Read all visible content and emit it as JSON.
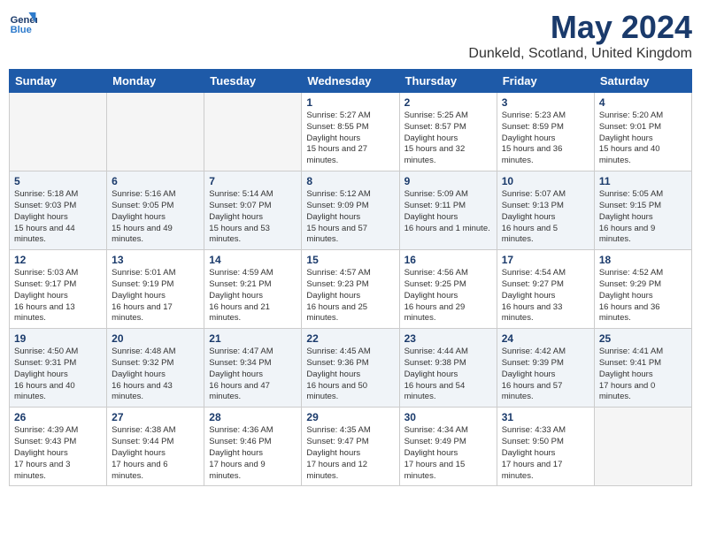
{
  "logo": {
    "line1": "General",
    "line2": "Blue"
  },
  "title": "May 2024",
  "subtitle": "Dunkeld, Scotland, United Kingdom",
  "days_of_week": [
    "Sunday",
    "Monday",
    "Tuesday",
    "Wednesday",
    "Thursday",
    "Friday",
    "Saturday"
  ],
  "weeks": [
    [
      {
        "day": "",
        "empty": true
      },
      {
        "day": "",
        "empty": true
      },
      {
        "day": "",
        "empty": true
      },
      {
        "day": "1",
        "sunrise": "5:27 AM",
        "sunset": "8:55 PM",
        "daylight": "15 hours and 27 minutes."
      },
      {
        "day": "2",
        "sunrise": "5:25 AM",
        "sunset": "8:57 PM",
        "daylight": "15 hours and 32 minutes."
      },
      {
        "day": "3",
        "sunrise": "5:23 AM",
        "sunset": "8:59 PM",
        "daylight": "15 hours and 36 minutes."
      },
      {
        "day": "4",
        "sunrise": "5:20 AM",
        "sunset": "9:01 PM",
        "daylight": "15 hours and 40 minutes."
      }
    ],
    [
      {
        "day": "5",
        "sunrise": "5:18 AM",
        "sunset": "9:03 PM",
        "daylight": "15 hours and 44 minutes."
      },
      {
        "day": "6",
        "sunrise": "5:16 AM",
        "sunset": "9:05 PM",
        "daylight": "15 hours and 49 minutes."
      },
      {
        "day": "7",
        "sunrise": "5:14 AM",
        "sunset": "9:07 PM",
        "daylight": "15 hours and 53 minutes."
      },
      {
        "day": "8",
        "sunrise": "5:12 AM",
        "sunset": "9:09 PM",
        "daylight": "15 hours and 57 minutes."
      },
      {
        "day": "9",
        "sunrise": "5:09 AM",
        "sunset": "9:11 PM",
        "daylight": "16 hours and 1 minute."
      },
      {
        "day": "10",
        "sunrise": "5:07 AM",
        "sunset": "9:13 PM",
        "daylight": "16 hours and 5 minutes."
      },
      {
        "day": "11",
        "sunrise": "5:05 AM",
        "sunset": "9:15 PM",
        "daylight": "16 hours and 9 minutes."
      }
    ],
    [
      {
        "day": "12",
        "sunrise": "5:03 AM",
        "sunset": "9:17 PM",
        "daylight": "16 hours and 13 minutes."
      },
      {
        "day": "13",
        "sunrise": "5:01 AM",
        "sunset": "9:19 PM",
        "daylight": "16 hours and 17 minutes."
      },
      {
        "day": "14",
        "sunrise": "4:59 AM",
        "sunset": "9:21 PM",
        "daylight": "16 hours and 21 minutes."
      },
      {
        "day": "15",
        "sunrise": "4:57 AM",
        "sunset": "9:23 PM",
        "daylight": "16 hours and 25 minutes."
      },
      {
        "day": "16",
        "sunrise": "4:56 AM",
        "sunset": "9:25 PM",
        "daylight": "16 hours and 29 minutes."
      },
      {
        "day": "17",
        "sunrise": "4:54 AM",
        "sunset": "9:27 PM",
        "daylight": "16 hours and 33 minutes."
      },
      {
        "day": "18",
        "sunrise": "4:52 AM",
        "sunset": "9:29 PM",
        "daylight": "16 hours and 36 minutes."
      }
    ],
    [
      {
        "day": "19",
        "sunrise": "4:50 AM",
        "sunset": "9:31 PM",
        "daylight": "16 hours and 40 minutes."
      },
      {
        "day": "20",
        "sunrise": "4:48 AM",
        "sunset": "9:32 PM",
        "daylight": "16 hours and 43 minutes."
      },
      {
        "day": "21",
        "sunrise": "4:47 AM",
        "sunset": "9:34 PM",
        "daylight": "16 hours and 47 minutes."
      },
      {
        "day": "22",
        "sunrise": "4:45 AM",
        "sunset": "9:36 PM",
        "daylight": "16 hours and 50 minutes."
      },
      {
        "day": "23",
        "sunrise": "4:44 AM",
        "sunset": "9:38 PM",
        "daylight": "16 hours and 54 minutes."
      },
      {
        "day": "24",
        "sunrise": "4:42 AM",
        "sunset": "9:39 PM",
        "daylight": "16 hours and 57 minutes."
      },
      {
        "day": "25",
        "sunrise": "4:41 AM",
        "sunset": "9:41 PM",
        "daylight": "17 hours and 0 minutes."
      }
    ],
    [
      {
        "day": "26",
        "sunrise": "4:39 AM",
        "sunset": "9:43 PM",
        "daylight": "17 hours and 3 minutes."
      },
      {
        "day": "27",
        "sunrise": "4:38 AM",
        "sunset": "9:44 PM",
        "daylight": "17 hours and 6 minutes."
      },
      {
        "day": "28",
        "sunrise": "4:36 AM",
        "sunset": "9:46 PM",
        "daylight": "17 hours and 9 minutes."
      },
      {
        "day": "29",
        "sunrise": "4:35 AM",
        "sunset": "9:47 PM",
        "daylight": "17 hours and 12 minutes."
      },
      {
        "day": "30",
        "sunrise": "4:34 AM",
        "sunset": "9:49 PM",
        "daylight": "17 hours and 15 minutes."
      },
      {
        "day": "31",
        "sunrise": "4:33 AM",
        "sunset": "9:50 PM",
        "daylight": "17 hours and 17 minutes."
      },
      {
        "day": "",
        "empty": true
      }
    ]
  ]
}
